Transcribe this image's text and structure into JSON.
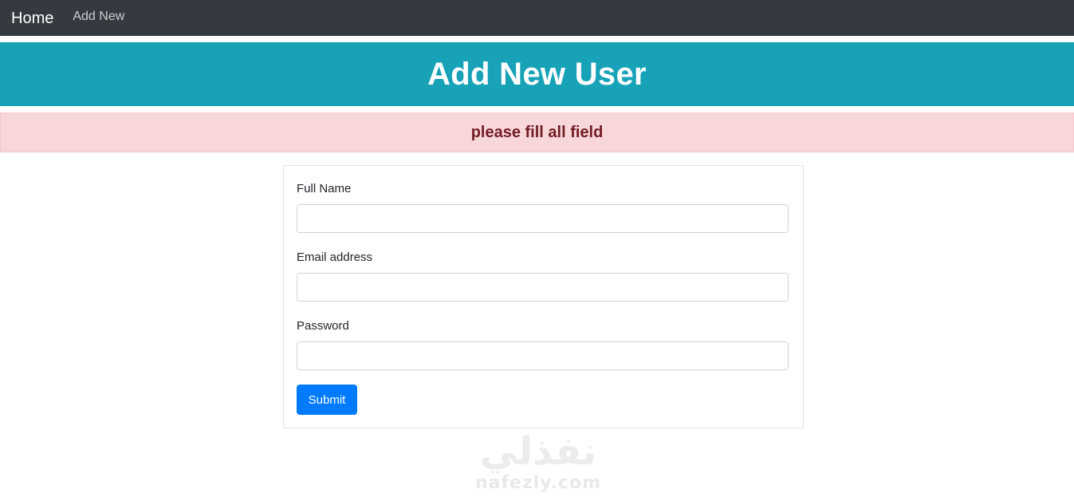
{
  "navbar": {
    "brand": "Home",
    "links": [
      {
        "label": "Add New"
      }
    ]
  },
  "hero": {
    "title": "Add New User"
  },
  "alert": {
    "message": "please fill all field",
    "type": "danger"
  },
  "form": {
    "fields": [
      {
        "label": "Full Name",
        "value": "",
        "type": "text"
      },
      {
        "label": "Email address",
        "value": "",
        "type": "email"
      },
      {
        "label": "Password",
        "value": "",
        "type": "password"
      }
    ],
    "submit_label": "Submit"
  },
  "watermark": {
    "arabic": "نفذلي",
    "latin": "nafezly.com"
  },
  "colors": {
    "navbar_bg": "#343a40",
    "hero_bg": "#17a2b8",
    "alert_bg": "#f8d7da",
    "alert_text": "#721c24",
    "primary": "#007bff"
  }
}
